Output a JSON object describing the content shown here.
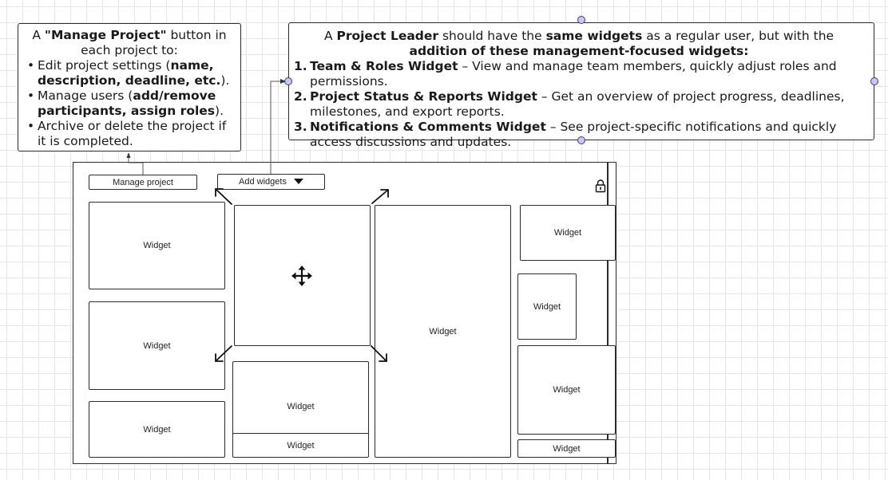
{
  "note_left": {
    "lead_pre": "A ",
    "lead_bold": "\"Manage Project\"",
    "lead_post": " button in each project to:",
    "item1_pre": "Edit project settings (",
    "item1_bold": "name, description, deadline, etc.",
    "item1_post": ").",
    "item2_pre": "Manage users (",
    "item2_bold": "add/remove participants, assign roles",
    "item2_post": ").",
    "item3": "Archive or delete the project if it is completed."
  },
  "note_right": {
    "lead_a": "A ",
    "lead_b": "Project Leader",
    "lead_c": " should have the ",
    "lead_d": "same widgets",
    "lead_e": " as a regular user, but with the ",
    "lead_f": "addition of these management-focused widgets:",
    "items": [
      {
        "num": "1.",
        "title": "Team & Roles Widget",
        "desc": " – View and manage team members, quickly adjust roles and permissions."
      },
      {
        "num": "2.",
        "title": "Project Status & Reports Widget",
        "desc": " – Get an overview of project progress, deadlines, milestones, and export reports."
      },
      {
        "num": "3.",
        "title": "Notifications & Comments Widget",
        "desc": " – See project-specific notifications and quickly access discussions and updates."
      }
    ]
  },
  "toolbar": {
    "manage_label": "Manage project",
    "add_widgets_label": "Add widgets"
  },
  "widget_label": "Widget",
  "icons": {
    "lock": "lock-icon",
    "move": "move-icon",
    "dropdown": "triangle-down-icon",
    "resize": "resize-arrow-icon"
  },
  "colors": {
    "handle_fill": "#c9c8f3",
    "handle_stroke": "#3a3a80",
    "line": "#2b2b2b"
  }
}
